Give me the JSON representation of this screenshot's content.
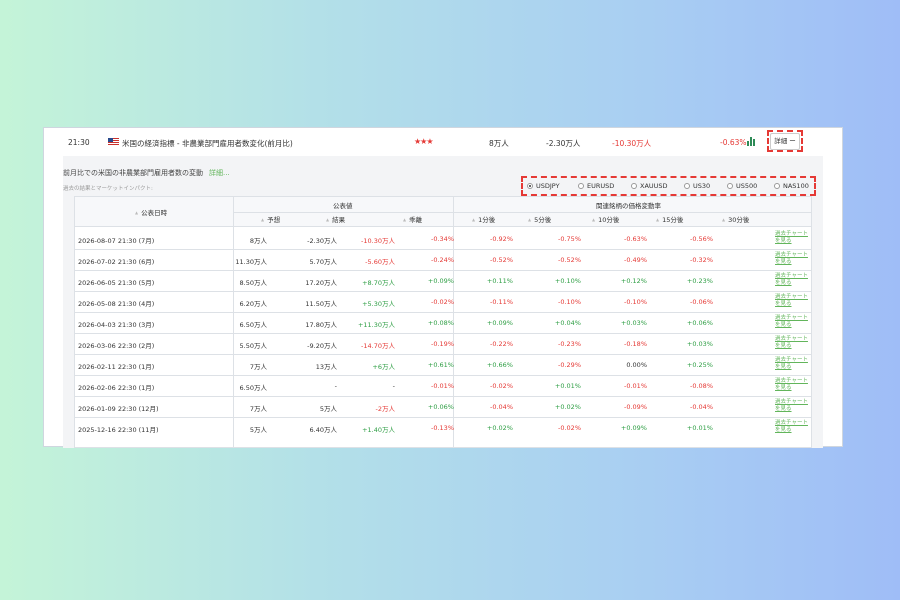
{
  "event": {
    "time": "21:30",
    "title": "米国の経済指標 - 非農業部門雇用者数変化(前月比)",
    "importance": "★★★",
    "forecast": "8万人",
    "actual": "-2.30万人",
    "previous": "-10.30万人",
    "change": "-0.63%",
    "detail_label": "詳細 ー"
  },
  "panel": {
    "title": "前月比での米国の非農業部門雇用者数の変動",
    "more_link": "詳細...",
    "subtitle": "過去の結果とマーケットインパクト:"
  },
  "instruments": [
    {
      "label": "USDJPY",
      "selected": true
    },
    {
      "label": "EURUSD",
      "selected": false
    },
    {
      "label": "XAUUSD",
      "selected": false
    },
    {
      "label": "US30",
      "selected": false
    },
    {
      "label": "US500",
      "selected": false
    },
    {
      "label": "NAS100",
      "selected": false
    }
  ],
  "table": {
    "headers": {
      "date": "公表日時",
      "group_values": "公表値",
      "forecast": "予想",
      "actual": "結果",
      "deviation": "乖離",
      "group_changes": "関連銘柄の価格変動率",
      "m1": "1分後",
      "m5": "5分後",
      "m10": "10分後",
      "m15": "15分後",
      "m30": "30分後"
    },
    "link_label": "過去チャートを見る",
    "rows": [
      {
        "date": "2026-08-07 21:30 (7月)",
        "forecast": "8万人",
        "actual": "-2.30万人",
        "deviation": "-10.30万人",
        "m1": "-0.34%",
        "m5": "-0.92%",
        "m10": "-0.75%",
        "m15": "-0.63%",
        "m30": "-0.56%"
      },
      {
        "date": "2026-07-02 21:30 (6月)",
        "forecast": "11.30万人",
        "actual": "5.70万人",
        "deviation": "-5.60万人",
        "m1": "-0.24%",
        "m5": "-0.52%",
        "m10": "-0.52%",
        "m15": "-0.49%",
        "m30": "-0.32%"
      },
      {
        "date": "2026-06-05 21:30 (5月)",
        "forecast": "8.50万人",
        "actual": "17.20万人",
        "deviation": "+8.70万人",
        "m1": "+0.09%",
        "m5": "+0.11%",
        "m10": "+0.10%",
        "m15": "+0.12%",
        "m30": "+0.23%"
      },
      {
        "date": "2026-05-08 21:30 (4月)",
        "forecast": "6.20万人",
        "actual": "11.50万人",
        "deviation": "+5.30万人",
        "m1": "-0.02%",
        "m5": "-0.11%",
        "m10": "-0.10%",
        "m15": "-0.10%",
        "m30": "-0.06%"
      },
      {
        "date": "2026-04-03 21:30 (3月)",
        "forecast": "6.50万人",
        "actual": "17.80万人",
        "deviation": "+11.30万人",
        "m1": "+0.08%",
        "m5": "+0.09%",
        "m10": "+0.04%",
        "m15": "+0.03%",
        "m30": "+0.06%"
      },
      {
        "date": "2026-03-06 22:30 (2月)",
        "forecast": "5.50万人",
        "actual": "-9.20万人",
        "deviation": "-14.70万人",
        "m1": "-0.19%",
        "m5": "-0.22%",
        "m10": "-0.23%",
        "m15": "-0.18%",
        "m30": "+0.03%"
      },
      {
        "date": "2026-02-11 22:30 (1月)",
        "forecast": "7万人",
        "actual": "13万人",
        "deviation": "+6万人",
        "m1": "+0.61%",
        "m5": "+0.66%",
        "m10": "-0.29%",
        "m15": "0.00%",
        "m30": "+0.25%"
      },
      {
        "date": "2026-02-06 22:30 (1月)",
        "forecast": "6.50万人",
        "actual": "-",
        "deviation": "-",
        "m1": "-0.01%",
        "m5": "-0.02%",
        "m10": "+0.01%",
        "m15": "-0.01%",
        "m30": "-0.08%"
      },
      {
        "date": "2026-01-09 22:30 (12月)",
        "forecast": "7万人",
        "actual": "5万人",
        "deviation": "-2万人",
        "m1": "+0.06%",
        "m5": "-0.04%",
        "m10": "+0.02%",
        "m15": "-0.09%",
        "m30": "-0.04%"
      },
      {
        "date": "2025-12-16 22:30 (11月)",
        "forecast": "5万人",
        "actual": "6.40万人",
        "deviation": "+1.40万人",
        "m1": "-0.13%",
        "m5": "+0.02%",
        "m10": "-0.02%",
        "m15": "+0.09%",
        "m30": "+0.01%"
      }
    ]
  },
  "colors": {
    "negative": "#e53935",
    "positive": "#2e9e44",
    "link": "#62b55b",
    "highlight": "#e53935"
  }
}
